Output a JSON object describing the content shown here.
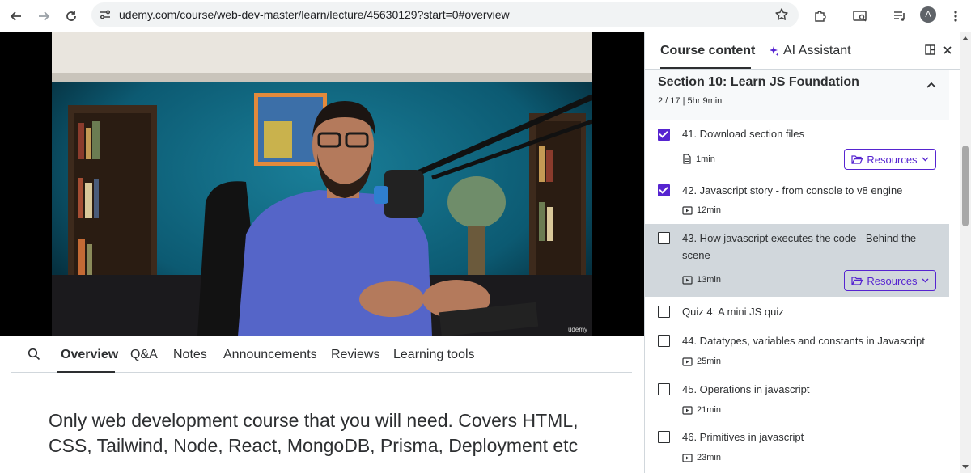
{
  "browser": {
    "url": "udemy.com/course/web-dev-master/learn/lecture/45630129?start=0#overview",
    "profile_initial": "A"
  },
  "video": {
    "watermark": "ûdemy"
  },
  "tabs": [
    {
      "label": "Overview",
      "active": true
    },
    {
      "label": "Q&A"
    },
    {
      "label": "Notes"
    },
    {
      "label": "Announcements"
    },
    {
      "label": "Reviews"
    },
    {
      "label": "Learning tools"
    }
  ],
  "description": "Only web development course that you will need. Covers HTML, CSS, Tailwind, Node, React, MongoDB, Prisma, Deployment etc",
  "sidebar": {
    "tab_course": "Course content",
    "tab_ai": "AI Assistant",
    "section": {
      "title": "Section 10: Learn JS Foundation",
      "meta": "2 / 17 | 5hr 9min"
    },
    "lectures": [
      {
        "title": "41. Download section files",
        "duration": "1min",
        "type": "file",
        "checked": true,
        "resources": "Resources"
      },
      {
        "title": "42. Javascript story - from console to v8 engine",
        "duration": "12min",
        "type": "video",
        "checked": true
      },
      {
        "title": "43. How javascript executes the code - Behind the scene",
        "duration": "13min",
        "type": "video",
        "checked": false,
        "current": true,
        "resources": "Resources"
      },
      {
        "title": "Quiz 4: A mini JS quiz",
        "checked": false
      },
      {
        "title": "44. Datatypes, variables and constants in Javascript",
        "duration": "25min",
        "type": "video",
        "checked": false
      },
      {
        "title": "45. Operations in javascript",
        "duration": "21min",
        "type": "video",
        "checked": false
      },
      {
        "title": "46. Primitives in javascript",
        "duration": "23min",
        "type": "video",
        "checked": false
      }
    ]
  },
  "colors": {
    "accent": "#5624d0",
    "current_row": "#d1d7dc",
    "text": "#2d2f31"
  }
}
